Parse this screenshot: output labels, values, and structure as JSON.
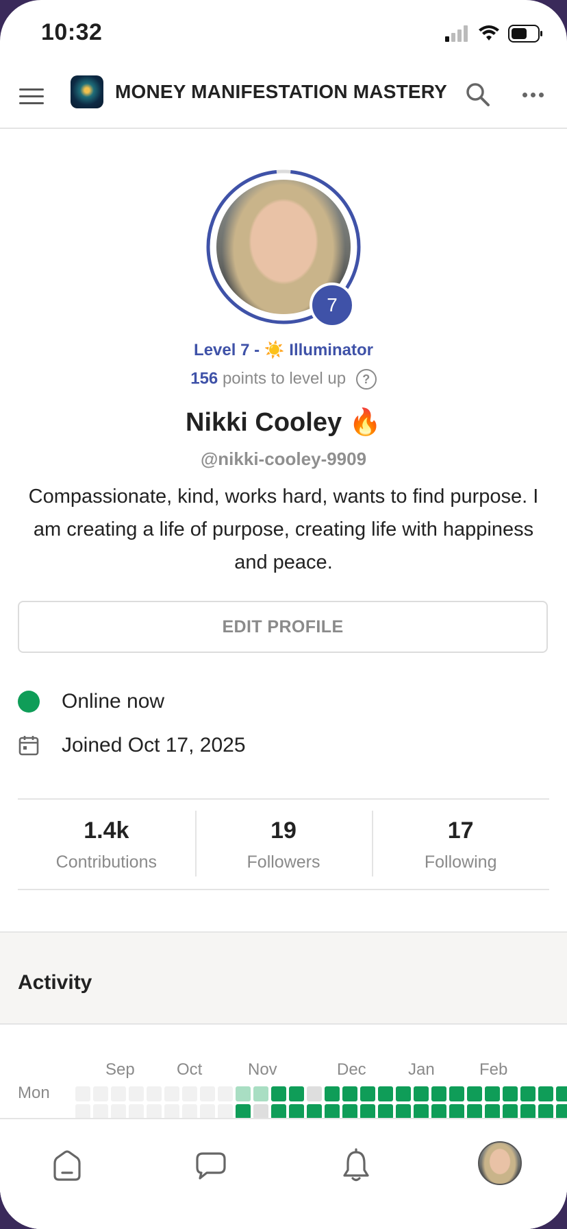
{
  "status_bar": {
    "time": "10:32"
  },
  "app_bar": {
    "title": "MONEY MANIFESTATION MASTERY"
  },
  "profile": {
    "level_badge": "7",
    "level_progress_fraction": 0.97,
    "level_text": "Level 7 - ☀️ Illuminator",
    "points_value": "156",
    "points_suffix": "points to level up",
    "help_glyph": "?",
    "name": "Nikki Cooley 🔥",
    "handle": "@nikki-cooley-9909",
    "bio": "Compassionate, kind, works hard, wants to find purpose. I am creating a life of purpose, creating life with happiness and peace.",
    "edit_button": "EDIT PROFILE",
    "online_status": "Online now",
    "joined": "Joined Oct 17, 2025"
  },
  "stats": [
    {
      "value": "1.4k",
      "label": "Contributions"
    },
    {
      "value": "19",
      "label": "Followers"
    },
    {
      "value": "17",
      "label": "Following"
    }
  ],
  "activity": {
    "title": "Activity",
    "months": [
      "Sep",
      "Oct",
      "Nov",
      "Dec",
      "Jan",
      "Feb"
    ],
    "day_labels": [
      "Mon"
    ],
    "row1": [
      "e",
      "e",
      "e",
      "e",
      "e",
      "e",
      "e",
      "e",
      "e",
      "l",
      "l",
      "g",
      "g",
      "d",
      "g",
      "g",
      "g",
      "g",
      "g",
      "g",
      "g",
      "g",
      "g",
      "g",
      "g",
      "g",
      "g",
      "g"
    ],
    "row2": [
      "e",
      "e",
      "e",
      "e",
      "e",
      "e",
      "e",
      "e",
      "e",
      "g",
      "d",
      "g",
      "g",
      "g",
      "g",
      "g",
      "g",
      "g",
      "g",
      "g",
      "g",
      "g",
      "g",
      "g",
      "g",
      "g",
      "g",
      "g"
    ]
  },
  "colors": {
    "accent": "#3f52a8",
    "online": "#0f9d58",
    "muted": "#8a8a8a"
  },
  "bottom_nav": [
    "home-icon",
    "chat-icon",
    "bell-icon",
    "profile-avatar"
  ]
}
